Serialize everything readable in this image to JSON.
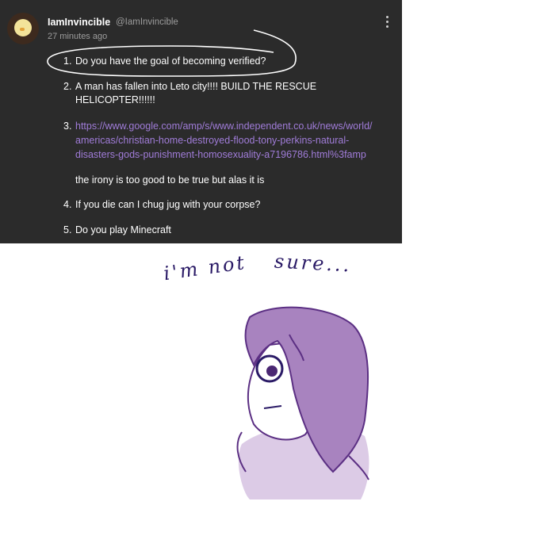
{
  "comment": {
    "user_name": "IamInvincible",
    "user_handle": "@IamInvincible",
    "timestamp": "27 minutes ago",
    "items": [
      {
        "number": "1.",
        "text": "Do you have the goal of becoming verified?"
      },
      {
        "number": "2.",
        "line1": "A man has fallen into Leto city!!!! BUILD THE RESCUE",
        "line2": "HELICOPTER!!!!!!"
      },
      {
        "number": "3.",
        "link_lines": [
          "https://www.google.com/amp/s/www.independent.co.uk/news/world/",
          "americas/christian-home-destroyed-flood-tony-perkins-natural-",
          "disasters-gods-punishment-homosexuality-a7196786.html%3famp"
        ],
        "note": "the irony is too good to be true but alas it is"
      },
      {
        "number": "4.",
        "text": "If you die can I chug jug with your corpse?"
      },
      {
        "number": "5.",
        "text": "Do you play Minecraft"
      }
    ],
    "icons": {
      "more": "more-vertical-icon",
      "avatar": "chick-avatar"
    }
  },
  "drawing": {
    "caption_part1": "i'm not",
    "caption_part2": "sure...",
    "colors": {
      "hair": "#a883bf",
      "outline": "#5b2f83",
      "skin": "#ffffff",
      "shirt": "#dccbe6",
      "ink": "#2a1a66"
    }
  }
}
